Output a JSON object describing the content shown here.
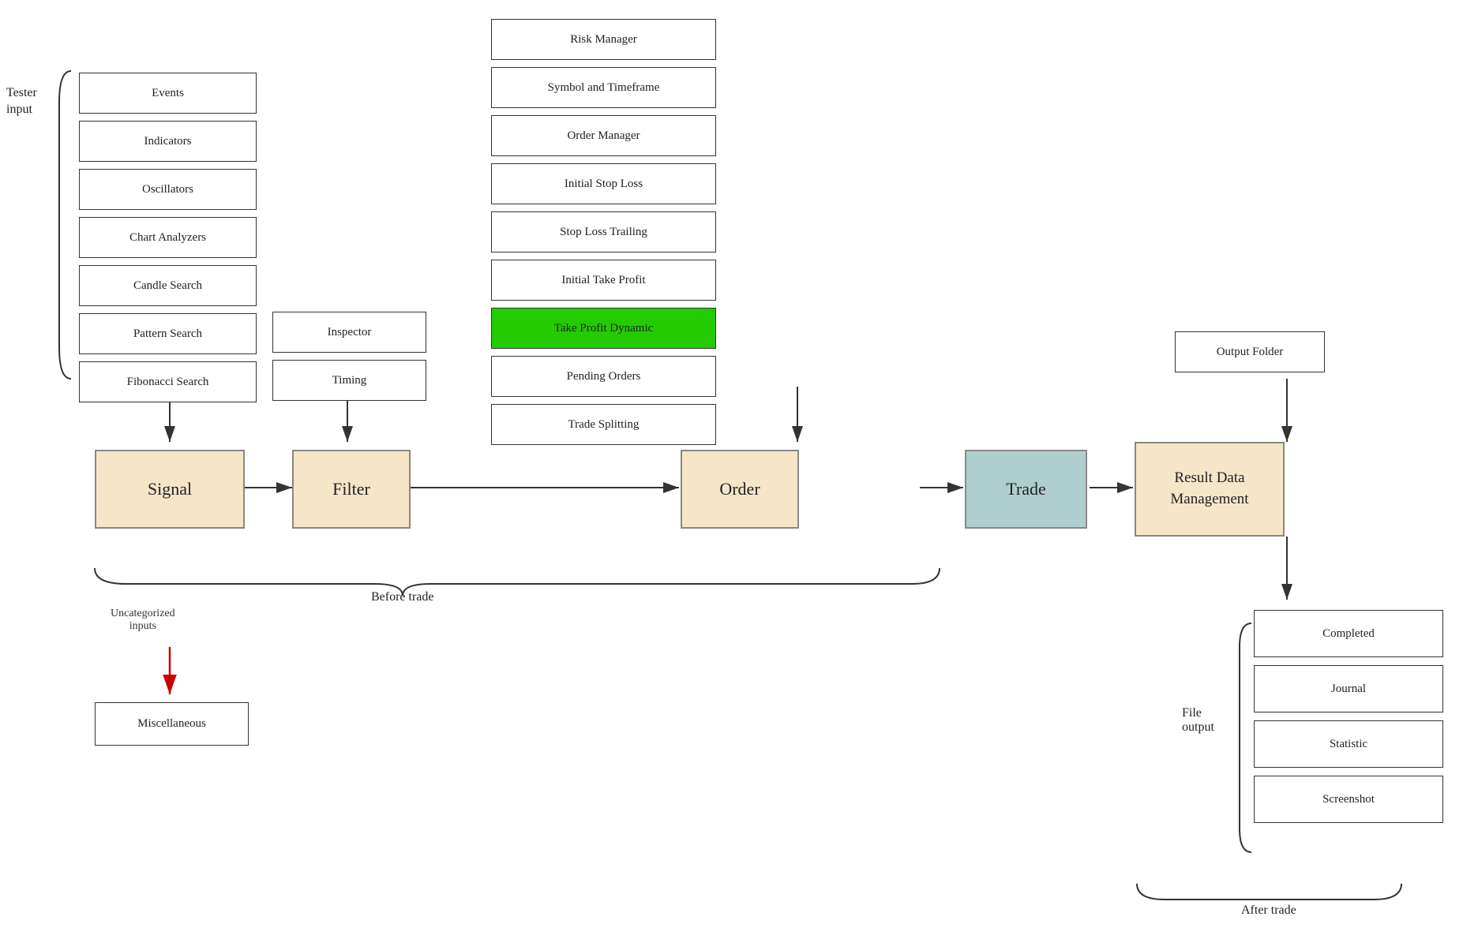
{
  "tester_input": {
    "label_line1": "Tester",
    "label_line2": "input"
  },
  "signal_inputs": [
    "Events",
    "Indicators",
    "Oscillators",
    "Chart Analyzers",
    "Candle Search",
    "Pattern Search",
    "Fibonacci Search"
  ],
  "filter_inputs": [
    "Inspector",
    "Timing"
  ],
  "order_inputs": [
    "Risk Manager",
    "Symbol and Timeframe",
    "Order Manager",
    "Initial Stop Loss",
    "Stop Loss Trailing",
    "Initial Take Profit",
    "Take Profit Dynamic",
    "Pending Orders",
    "Trade Splitting"
  ],
  "process_boxes": {
    "signal": "Signal",
    "filter": "Filter",
    "order": "Order",
    "trade": "Trade",
    "result": "Result Data\nManagement"
  },
  "output_folder": "Output Folder",
  "file_outputs": [
    "Completed",
    "Journal",
    "Statistic",
    "Screenshot"
  ],
  "miscellaneous": "Miscellaneous",
  "uncategorized_label": "Uncategorized\ninputs",
  "before_trade_label": "Before trade",
  "file_output_label": "File\noutput",
  "after_trade_label": "After trade"
}
